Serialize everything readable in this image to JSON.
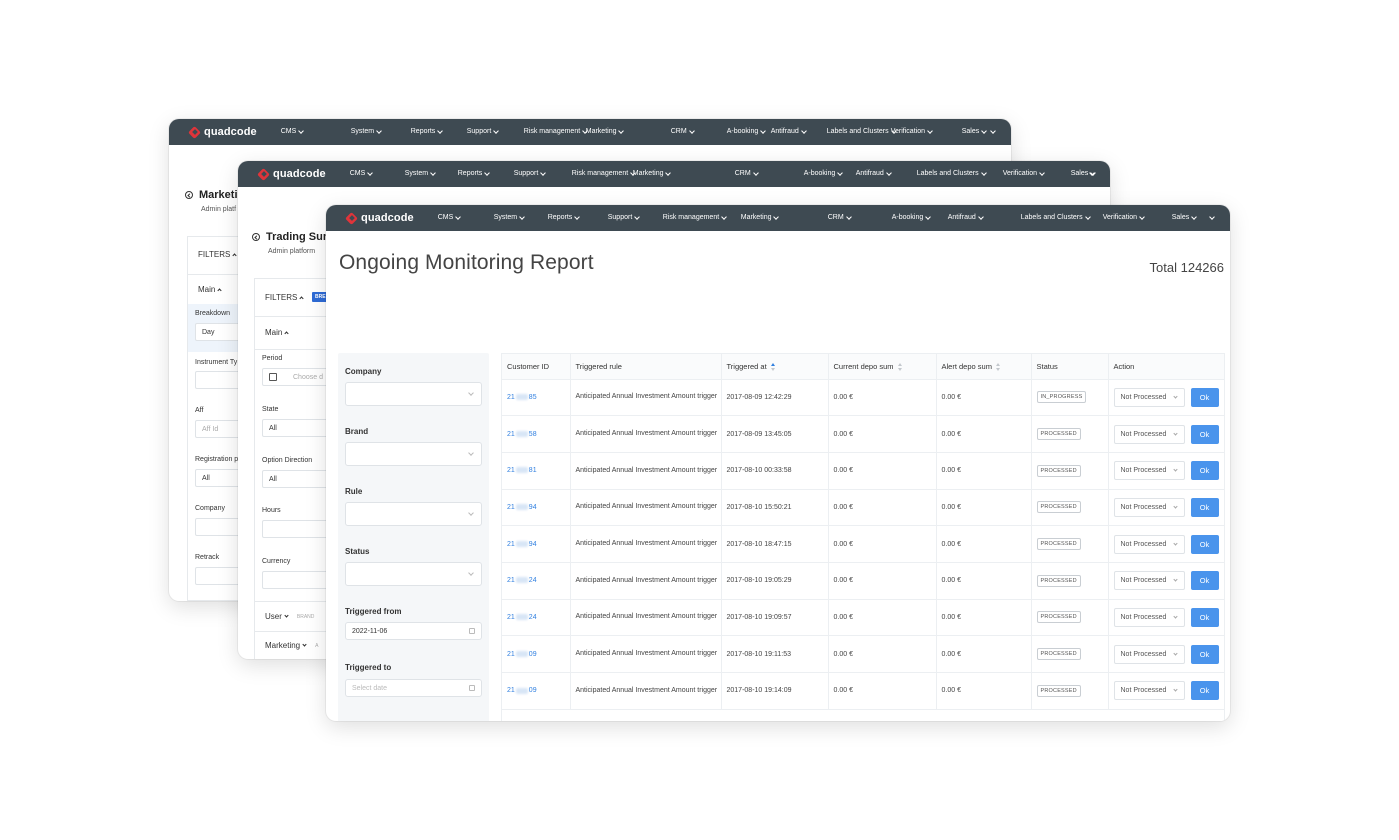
{
  "nav": {
    "logo": "quadcode",
    "items": [
      "CMS",
      "System",
      "Reports",
      "Support",
      "Risk management",
      "Marketing",
      "CRM",
      "A-booking",
      "Antifraud",
      "Labels and Clusters",
      "Verification",
      "Sales"
    ]
  },
  "back_window": {
    "title": "Marketin",
    "subtitle": "Admin platf",
    "filters_label": "FILTERS",
    "main_label": "Main",
    "breakdown_label": "Breakdown",
    "breakdown_value": "Day",
    "instrument_label": "Instrument Ty",
    "aff_label": "Aff",
    "aff_placeholder": "Aff Id",
    "registration_label": "Registration p",
    "registration_value": "All",
    "company_label": "Company",
    "retrack_label": "Retrack"
  },
  "mid_window": {
    "title": "Trading Sun",
    "subtitle": "Admin platform",
    "filters_label": "FILTERS",
    "badge": "BRE",
    "main_label": "Main",
    "period_label": "Period",
    "period_placeholder": "Choose d",
    "state_label": "State",
    "state_value": "All",
    "option_direction_label": "Option Direction",
    "option_direction_value": "All",
    "hours_label": "Hours",
    "currency_label": "Currency",
    "user_label": "User",
    "user_tag": "BRAND",
    "marketing_label": "Marketing",
    "marketing_tag": "A"
  },
  "report": {
    "title": "Ongoing Monitoring Report",
    "total": "Total 124266",
    "filters": {
      "company": "Company",
      "brand": "Brand",
      "rule": "Rule",
      "status": "Status",
      "triggered_from": "Triggered from",
      "triggered_from_value": "2022-11-06",
      "triggered_to": "Triggered to",
      "triggered_to_placeholder": "Select date"
    },
    "columns": [
      "Customer ID",
      "Triggered rule",
      "Triggered at",
      "Current depo sum",
      "Alert depo sum",
      "Status",
      "Action"
    ],
    "rows": [
      {
        "id_start": "21",
        "id_end": "85",
        "rule": "Anticipated Annual Investment Amount trigger",
        "at": "2017-08-09 12:42:29",
        "current": "0.00 €",
        "alert": "0.00 €",
        "status": "IN_PROGRESS",
        "action": "Not Processed",
        "ok": "Ok"
      },
      {
        "id_start": "21",
        "id_end": "58",
        "rule": "Anticipated Annual Investment Amount trigger",
        "at": "2017-08-09 13:45:05",
        "current": "0.00 €",
        "alert": "0.00 €",
        "status": "PROCESSED",
        "action": "Not Processed",
        "ok": "Ok"
      },
      {
        "id_start": "21",
        "id_end": "81",
        "rule": "Anticipated Annual Investment Amount trigger",
        "at": "2017-08-10 00:33:58",
        "current": "0.00 €",
        "alert": "0.00 €",
        "status": "PROCESSED",
        "action": "Not Processed",
        "ok": "Ok"
      },
      {
        "id_start": "21",
        "id_end": "94",
        "rule": "Anticipated Annual Investment Amount trigger",
        "at": "2017-08-10 15:50:21",
        "current": "0.00 €",
        "alert": "0.00 €",
        "status": "PROCESSED",
        "action": "Not Processed",
        "ok": "Ok"
      },
      {
        "id_start": "21",
        "id_end": "94",
        "rule": "Anticipated Annual Investment Amount trigger",
        "at": "2017-08-10 18:47:15",
        "current": "0.00 €",
        "alert": "0.00 €",
        "status": "PROCESSED",
        "action": "Not Processed",
        "ok": "Ok"
      },
      {
        "id_start": "21",
        "id_end": "24",
        "rule": "Anticipated Annual Investment Amount trigger",
        "at": "2017-08-10 19:05:29",
        "current": "0.00 €",
        "alert": "0.00 €",
        "status": "PROCESSED",
        "action": "Not Processed",
        "ok": "Ok"
      },
      {
        "id_start": "21",
        "id_end": "24",
        "rule": "Anticipated Annual Investment Amount trigger",
        "at": "2017-08-10 19:09:57",
        "current": "0.00 €",
        "alert": "0.00 €",
        "status": "PROCESSED",
        "action": "Not Processed",
        "ok": "Ok"
      },
      {
        "id_start": "21",
        "id_end": "09",
        "rule": "Anticipated Annual Investment Amount trigger",
        "at": "2017-08-10 19:11:53",
        "current": "0.00 €",
        "alert": "0.00 €",
        "status": "PROCESSED",
        "action": "Not Processed",
        "ok": "Ok"
      },
      {
        "id_start": "21",
        "id_end": "09",
        "rule": "Anticipated Annual Investment Amount trigger",
        "at": "2017-08-10 19:14:09",
        "current": "0.00 €",
        "alert": "0.00 €",
        "status": "PROCESSED",
        "action": "Not Processed",
        "ok": "Ok"
      }
    ]
  }
}
